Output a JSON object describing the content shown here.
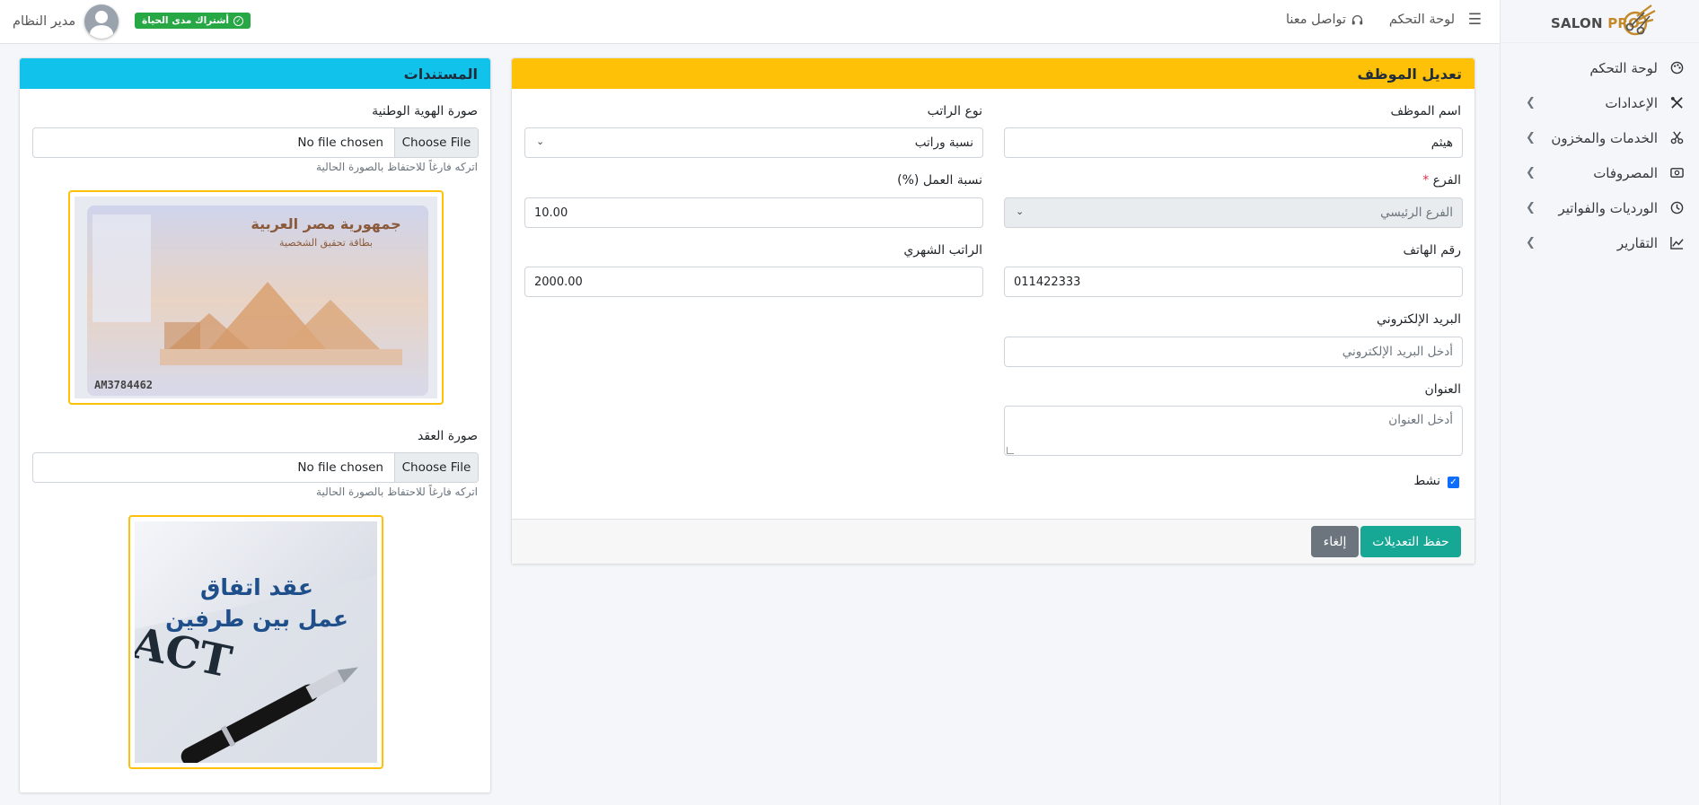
{
  "brand": {
    "name": "SALON",
    "name_suffix": "PRO"
  },
  "sidebar": {
    "items": [
      {
        "label": "لوحة التحكم",
        "icon": "palette-icon",
        "has_submenu": false
      },
      {
        "label": "الإعدادات",
        "icon": "tools-icon",
        "has_submenu": true
      },
      {
        "label": "الخدمات والمخزون",
        "icon": "scissors-icon",
        "has_submenu": true
      },
      {
        "label": "المصروفات",
        "icon": "cash-icon",
        "has_submenu": true
      },
      {
        "label": "الورديات والفواتير",
        "icon": "clock-icon",
        "has_submenu": true
      },
      {
        "label": "التقارير",
        "icon": "chart-line-icon",
        "has_submenu": true
      }
    ]
  },
  "topbar": {
    "dashboard_link": "لوحة التحكم",
    "contact_link": "تواصل معنا",
    "subscription_badge": "أشتراك مدى الحياة",
    "user_name": "مدير النظام"
  },
  "edit_card": {
    "title": "تعديل الموظف",
    "fields": {
      "employee_name": {
        "label": "اسم الموظف",
        "value": "هيثم"
      },
      "salary_type": {
        "label": "نوع الراتب",
        "value": "نسبة وراتب"
      },
      "branch": {
        "label": "الفرع",
        "required_mark": "*",
        "value": "الفرع الرئيسي"
      },
      "work_percentage": {
        "label": "نسبة العمل (%)",
        "value": "10.00"
      },
      "phone": {
        "label": "رقم الهاتف",
        "value": "011422333"
      },
      "monthly_salary": {
        "label": "الراتب الشهري",
        "value": "2000.00"
      },
      "email": {
        "label": "البريد الإلكتروني",
        "placeholder": "أدخل البريد الإلكتروني"
      },
      "address": {
        "label": "العنوان",
        "placeholder": "أدخل العنوان"
      },
      "active": {
        "label": "نشط",
        "checked": true
      }
    },
    "buttons": {
      "save": "حفظ التعديلات",
      "cancel": "إلغاء"
    }
  },
  "docs_card": {
    "title": "المستندات",
    "national_id": {
      "label": "صورة الهوية الوطنية",
      "choose_button": "Choose File",
      "file_status": "No file chosen",
      "hint": "اتركه فارغاً للاحتفاظ بالصورة الحالية",
      "card_header_line1": "جمهورية مصر العربية",
      "card_header_line2": "بطاقة تحقيق الشخصية",
      "card_number": "AM3784462"
    },
    "contract": {
      "label": "صورة العقد",
      "choose_button": "Choose File",
      "file_status": "No file chosen",
      "hint": "اتركه فارغاً للاحتفاظ بالصورة الحالية",
      "image_line1": "عقد اتفاق",
      "image_line2": "عمل بين طرفين"
    }
  },
  "colors": {
    "edit_header": "#ffc107",
    "docs_header": "#11c2ea",
    "save_button": "#17a895",
    "cancel_button": "#6c757d",
    "badge": "#28a745"
  }
}
